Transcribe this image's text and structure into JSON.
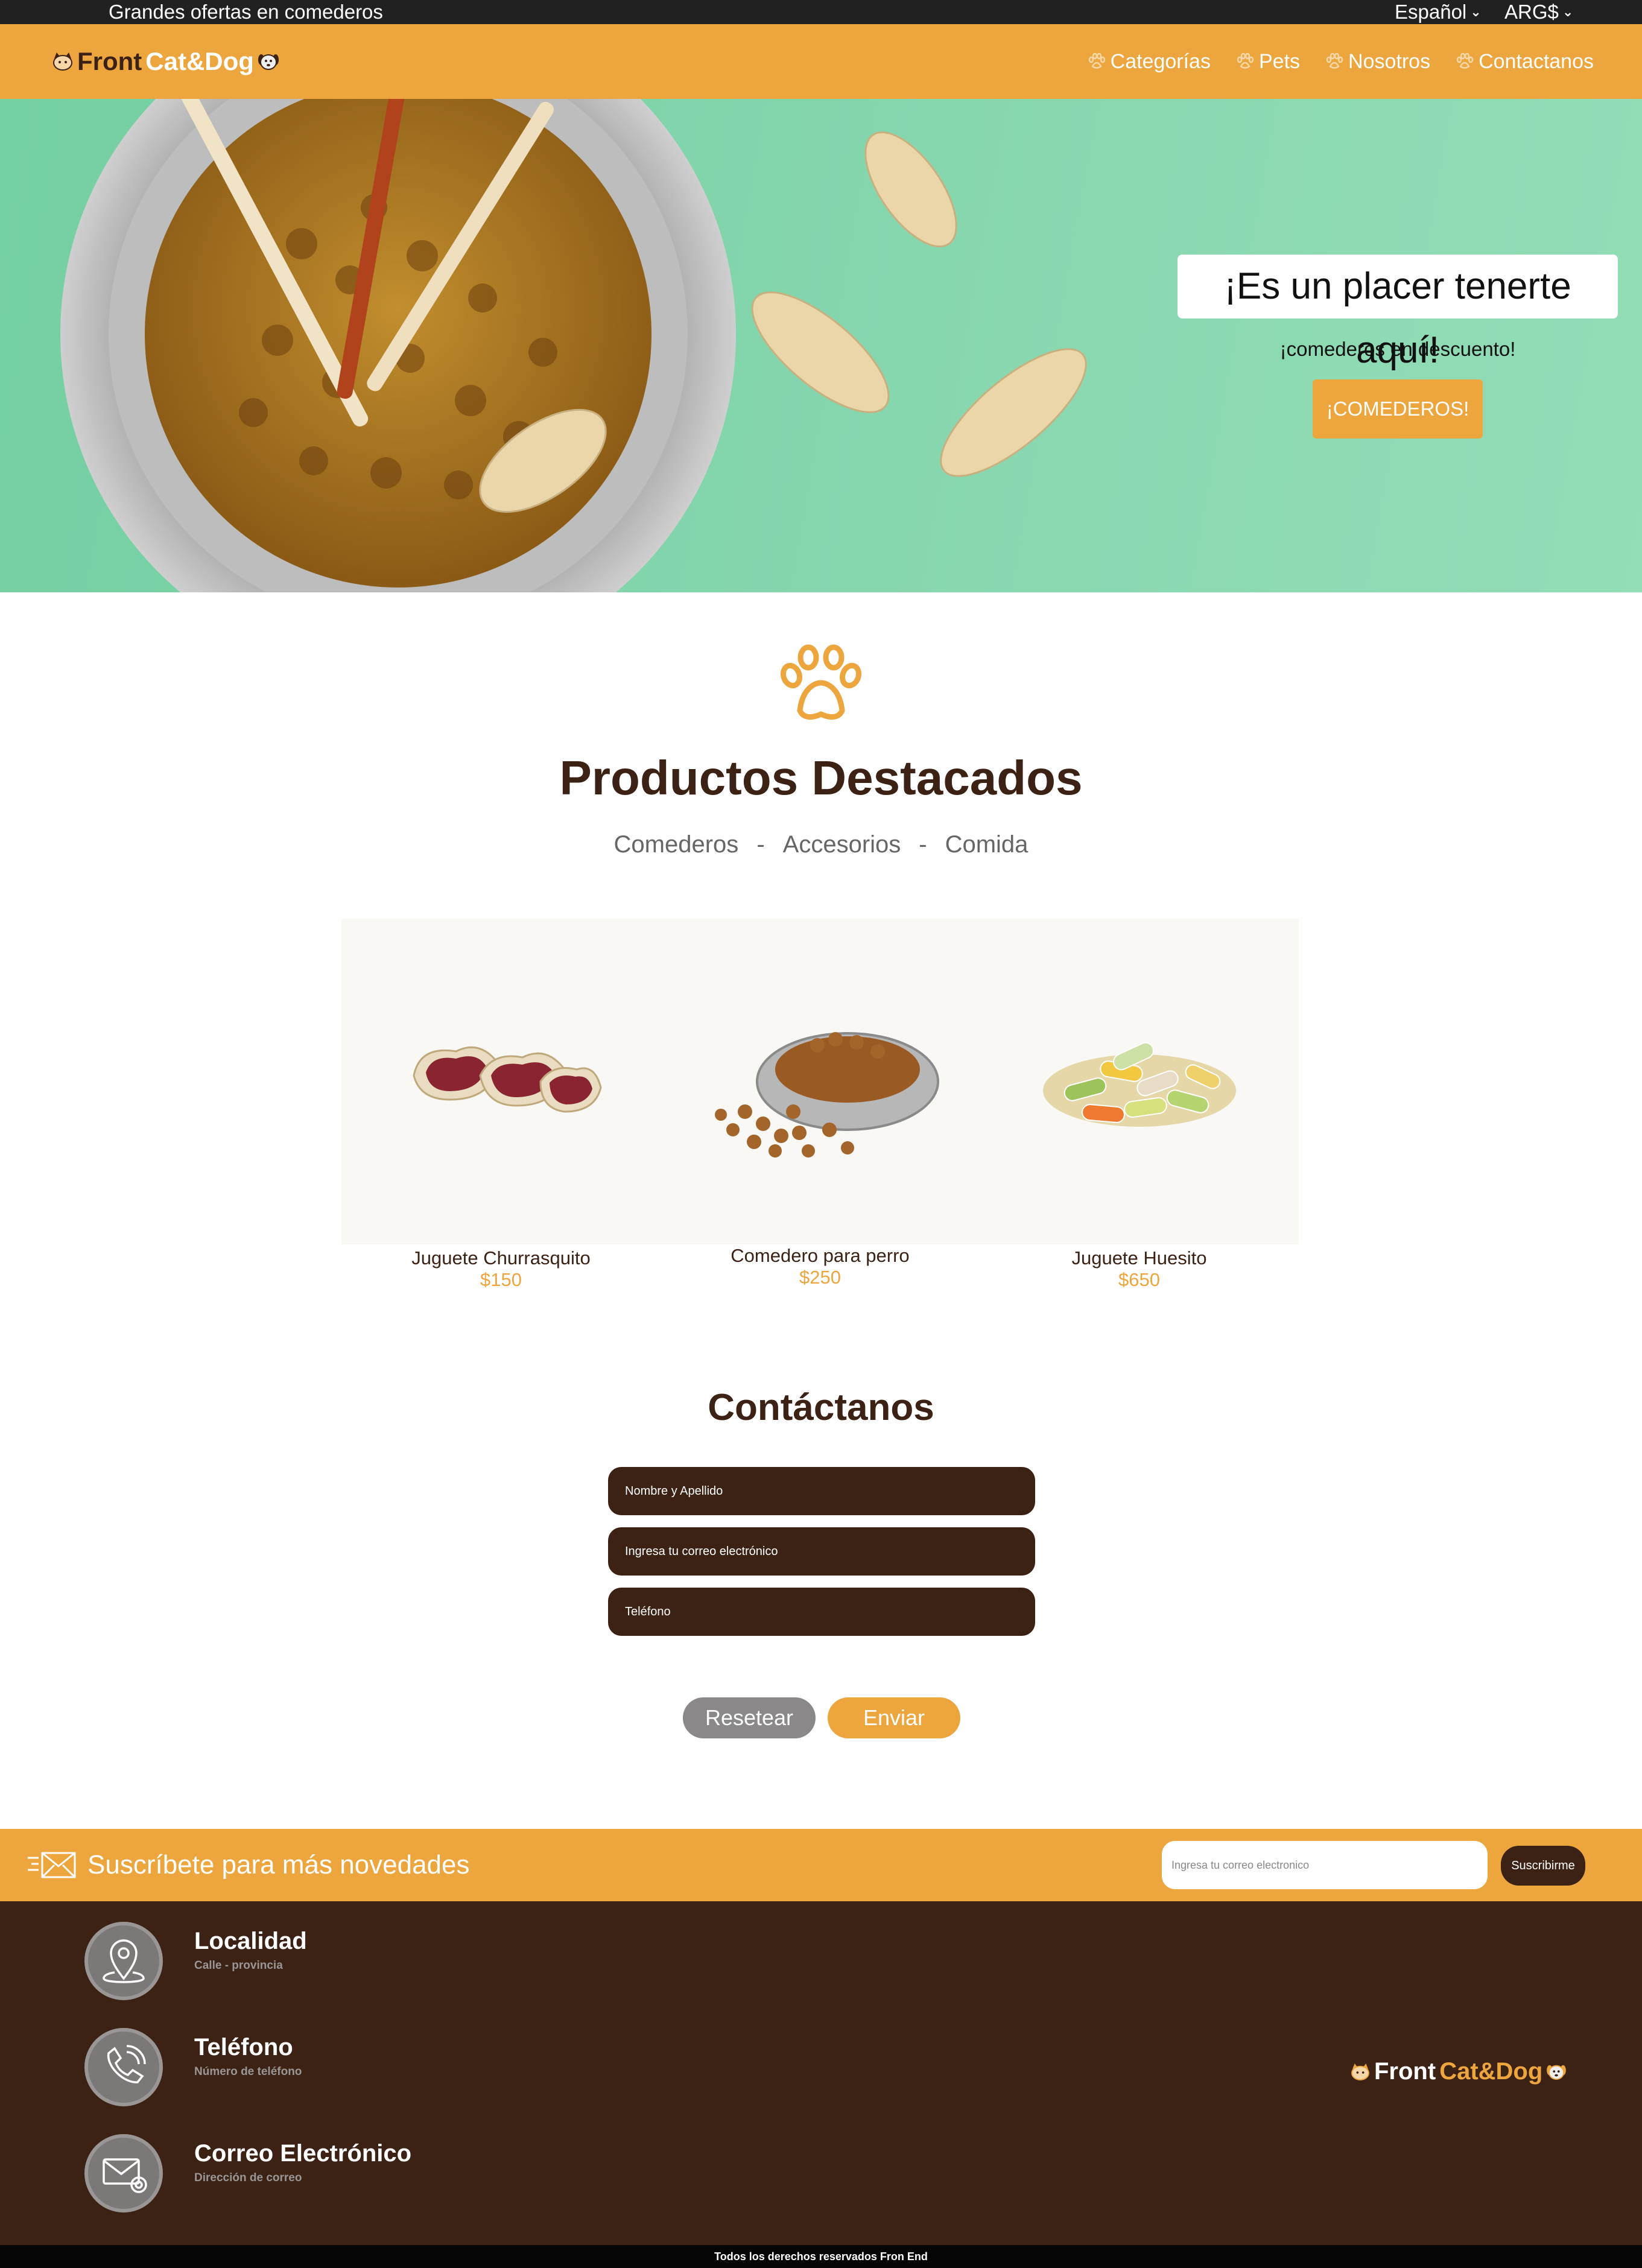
{
  "topbar": {
    "promo": "Grandes ofertas en comederos",
    "language": "Español",
    "currency": "ARG$"
  },
  "brand": {
    "front": "Front",
    "catdog": "Cat&Dog",
    "icon": "cat-dog-logo-icon"
  },
  "nav": {
    "items": [
      {
        "label": "Categorías",
        "icon": "paw-icon"
      },
      {
        "label": "Pets",
        "icon": "paw-icon"
      },
      {
        "label": "Nosotros",
        "icon": "paw-icon"
      },
      {
        "label": "Contactanos",
        "icon": "paw-icon"
      }
    ]
  },
  "hero": {
    "title": "¡Es un placer tenerte aquí!",
    "subtitle": "¡comederos en descuento!",
    "button": "¡COMEDEROS!"
  },
  "featured": {
    "title": "Productos Destacados",
    "filters": [
      "Comederos",
      "-",
      "Accesorios",
      "-",
      "Comida"
    ],
    "products": [
      {
        "name": "Juguete Churrasquito",
        "price": "$150"
      },
      {
        "name": "Comedero para perro",
        "price": "$250"
      },
      {
        "name": "Juguete Huesito",
        "price": "$650"
      }
    ]
  },
  "contact": {
    "title": "Contáctanos",
    "name_placeholder": "Nombre y Apellido",
    "email_placeholder": "Ingresa tu correo electrónico",
    "phone_placeholder": "Teléfono",
    "reset": "Resetear",
    "send": "Enviar"
  },
  "subscribe": {
    "text": "Suscríbete para más novedades",
    "placeholder": "Ingresa tu correo electronico",
    "button": "Suscribirme"
  },
  "footer": {
    "items": [
      {
        "title": "Localidad",
        "subtitle": "Calle - provincia",
        "icon": "location-pin-icon"
      },
      {
        "title": "Teléfono",
        "subtitle": "Número de teléfono",
        "icon": "phone-icon"
      },
      {
        "title": "Correo Electrónico",
        "subtitle": "Dirección de correo",
        "icon": "mail-icon"
      }
    ],
    "copyright": "Todos los derechos reservados Fron End"
  },
  "colors": {
    "accent": "#eda63e",
    "brown": "#3c2115",
    "topbar": "#212121",
    "hero_bg": "#86d6ae"
  }
}
